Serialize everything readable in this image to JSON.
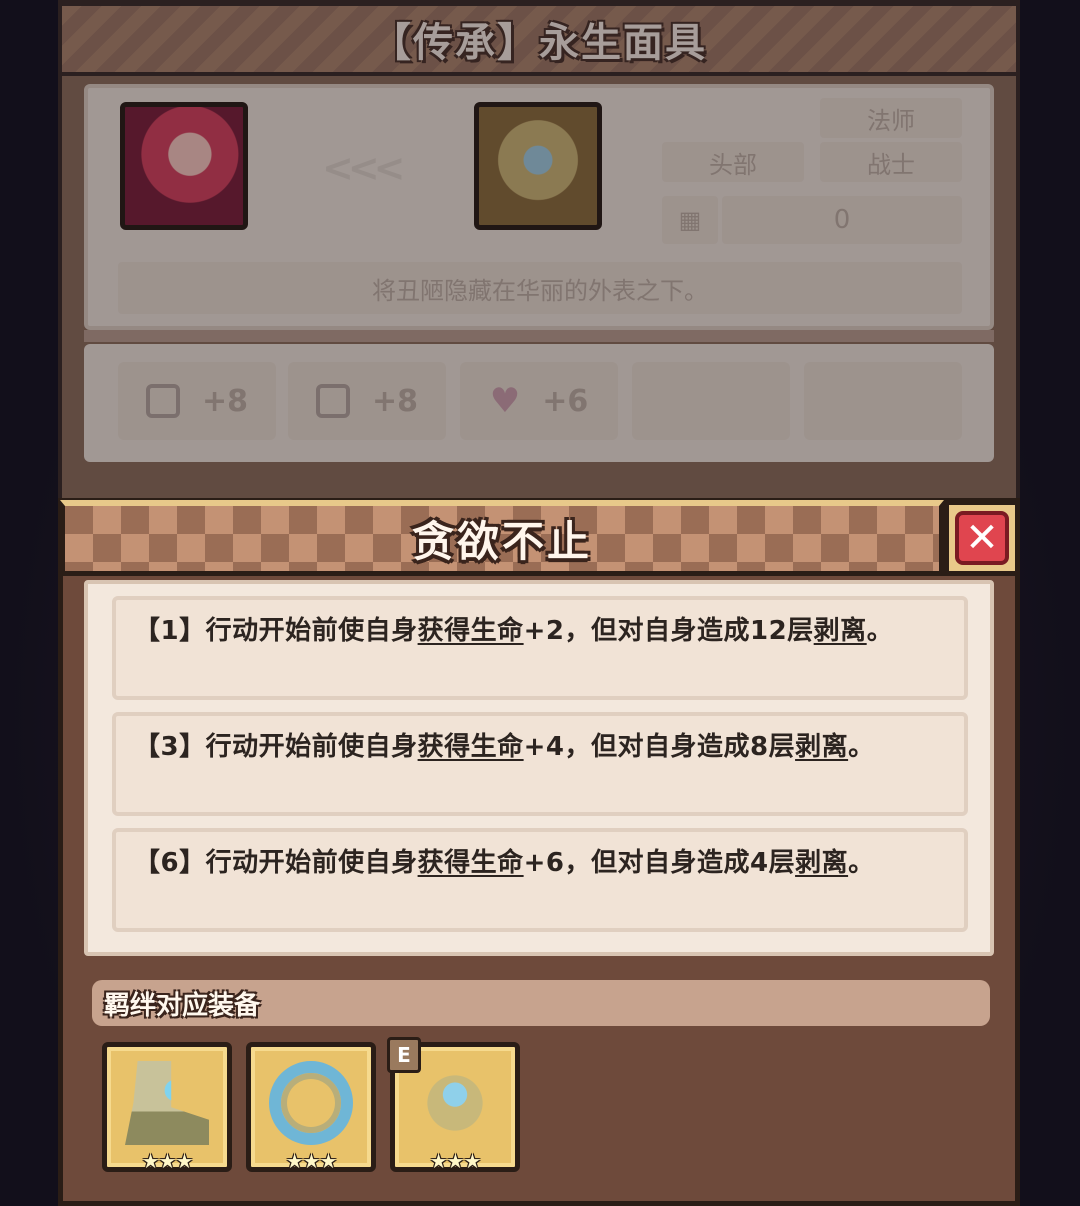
{
  "background_panel": {
    "title": "【传承】永生面具",
    "arrows": "<<<",
    "tags": {
      "slot": "头部",
      "class_1": "法师",
      "class_2": "战士"
    },
    "count_value": "0",
    "description": "将丑陋隐藏在华丽的外表之下。",
    "stats": [
      {
        "icon": "shield-icon",
        "value": "+8"
      },
      {
        "icon": "book-icon",
        "value": "+8"
      },
      {
        "icon": "heart-icon",
        "value": "+6"
      }
    ]
  },
  "popup": {
    "title": "贪欲不止",
    "close_icon": "close-icon",
    "effects": [
      {
        "prefix": "【1】行动开始前使自身",
        "keyword_1": "获得生命",
        "middle": "+2，但对自身造成12层",
        "keyword_2": "剥离",
        "suffix": "。"
      },
      {
        "prefix": "【3】行动开始前使自身",
        "keyword_1": "获得生命",
        "middle": "+4，但对自身造成8层",
        "keyword_2": "剥离",
        "suffix": "。"
      },
      {
        "prefix": "【6】行动开始前使自身",
        "keyword_1": "获得生命",
        "middle": "+6，但对自身造成4层",
        "keyword_2": "剥离",
        "suffix": "。"
      }
    ],
    "bond_title": "羁绊对应装备",
    "equipment": [
      {
        "icon": "boots-icon",
        "stars": "★★★"
      },
      {
        "icon": "ring-icon",
        "stars": "★★★"
      },
      {
        "icon": "mask-icon",
        "stars": "★★★",
        "badge": "E"
      }
    ]
  },
  "colors": {
    "panel_brown": "#6e4a3b",
    "header_tan": "#c49274",
    "close_red": "#e0454f",
    "effect_bg": "#f3e8dd",
    "equip_gold": "#e8c26a"
  }
}
